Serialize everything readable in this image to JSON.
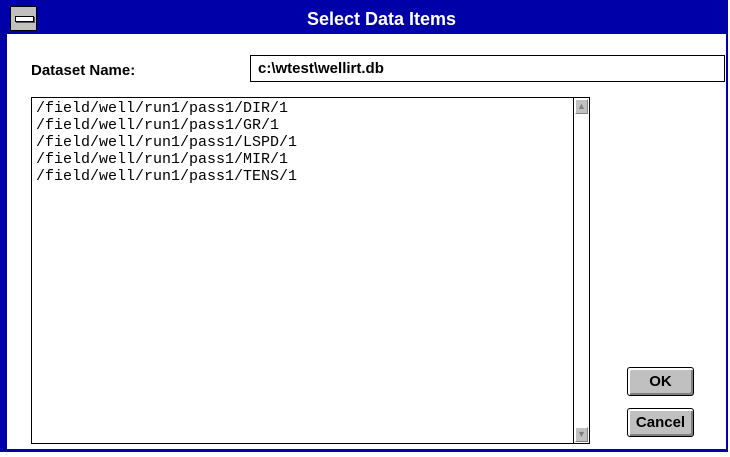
{
  "window": {
    "title": "Select Data Items"
  },
  "dataset": {
    "label": "Dataset Name:",
    "value": "c:\\wtest\\wellirt.db"
  },
  "list": {
    "items": [
      "/field/well/run1/pass1/DIR/1",
      "/field/well/run1/pass1/GR/1",
      "/field/well/run1/pass1/LSPD/1",
      "/field/well/run1/pass1/MIR/1",
      "/field/well/run1/pass1/TENS/1"
    ]
  },
  "buttons": {
    "ok_label": "OK",
    "cancel_label": "Cancel"
  },
  "icons": {
    "system_menu": "system-menu-icon",
    "scroll_up": "up-arrow-icon",
    "scroll_down": "down-arrow-icon"
  },
  "colors": {
    "titlebar": "#0000a8",
    "button_face": "#c0c0c0"
  }
}
